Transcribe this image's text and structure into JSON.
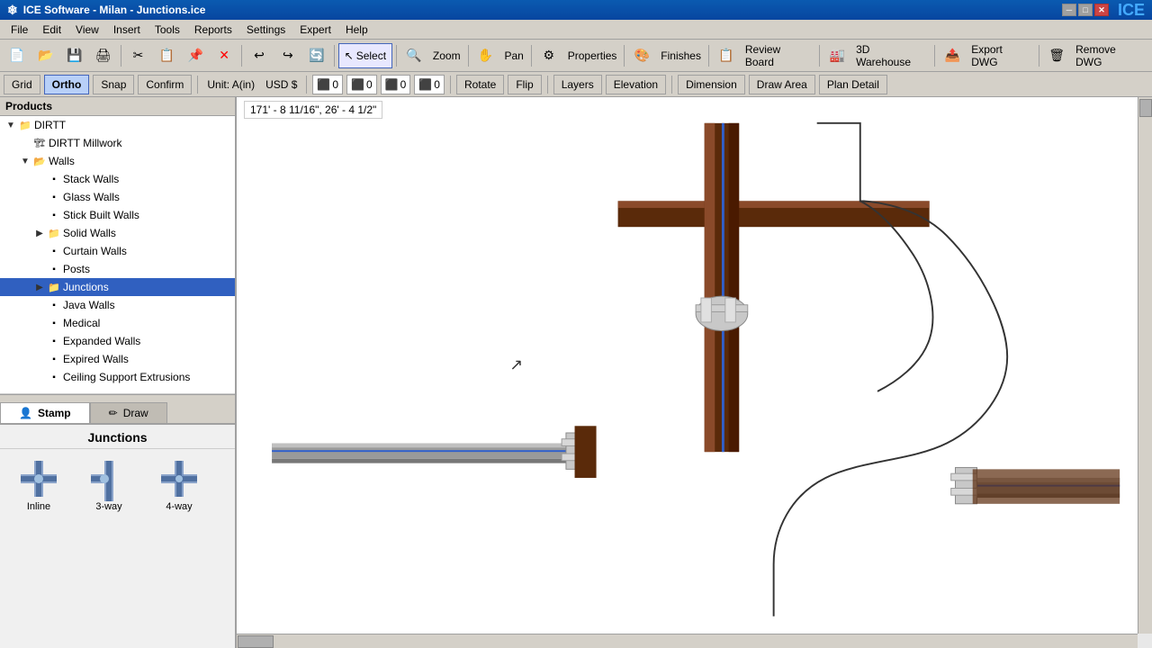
{
  "titlebar": {
    "title": "ICE Software - Milan - Junctions.ice",
    "logo": "ICE",
    "controls": [
      "─",
      "□",
      "✕"
    ]
  },
  "menu": {
    "items": [
      "File",
      "Edit",
      "View",
      "Insert",
      "Tools",
      "Reports",
      "Settings",
      "Expert",
      "Help"
    ]
  },
  "toolbar": {
    "select_label": "Select",
    "zoom_label": "Zoom",
    "pan_label": "Pan",
    "properties_label": "Properties",
    "finishes_label": "Finishes",
    "review_board_label": "Review Board",
    "warehouse_label": "3D Warehouse",
    "export_dwg_label": "Export DWG",
    "remove_dwg_label": "Remove DWG"
  },
  "toolbar2": {
    "grid_label": "Grid",
    "ortho_label": "Ortho",
    "snap_label": "Snap",
    "confirm_label": "Confirm",
    "unit_label": "Unit: A(in)",
    "currency_label": "USD $",
    "counters": [
      {
        "icon": "🔴",
        "value": "0"
      },
      {
        "icon": "🟡",
        "value": "0"
      },
      {
        "icon": "🟢",
        "value": "0"
      },
      {
        "icon": "🟠",
        "value": "0"
      }
    ],
    "rotate_label": "Rotate",
    "flip_label": "Flip",
    "layers_label": "Layers",
    "elevation_label": "Elevation",
    "dimension_label": "Dimension",
    "draw_area_label": "Draw Area",
    "plan_detail_label": "Plan Detail"
  },
  "tree": {
    "header": "Products",
    "nodes": [
      {
        "id": "dirtt",
        "label": "DIRTT",
        "level": 0,
        "expandable": true,
        "expanded": true,
        "type": "folder"
      },
      {
        "id": "dirtt-millwork",
        "label": "DIRTT Millwork",
        "level": 1,
        "expandable": false,
        "type": "item"
      },
      {
        "id": "walls",
        "label": "Walls",
        "level": 1,
        "expandable": true,
        "expanded": true,
        "type": "folder"
      },
      {
        "id": "stack-walls",
        "label": "Stack Walls",
        "level": 2,
        "expandable": false,
        "type": "item"
      },
      {
        "id": "glass-walls",
        "label": "Glass Walls",
        "level": 2,
        "expandable": false,
        "type": "item"
      },
      {
        "id": "stick-built-walls",
        "label": "Stick Built Walls",
        "level": 2,
        "expandable": false,
        "type": "item"
      },
      {
        "id": "solid-walls",
        "label": "Solid Walls",
        "level": 2,
        "expandable": true,
        "expanded": false,
        "type": "folder"
      },
      {
        "id": "curtain-walls",
        "label": "Curtain Walls",
        "level": 2,
        "expandable": false,
        "type": "item"
      },
      {
        "id": "posts",
        "label": "Posts",
        "level": 2,
        "expandable": false,
        "type": "item"
      },
      {
        "id": "junctions",
        "label": "Junctions",
        "level": 2,
        "expandable": true,
        "selected": true,
        "type": "folder"
      },
      {
        "id": "java-walls",
        "label": "Java Walls",
        "level": 2,
        "expandable": false,
        "type": "item"
      },
      {
        "id": "medical",
        "label": "Medical",
        "level": 2,
        "expandable": false,
        "type": "item"
      },
      {
        "id": "expanded-walls",
        "label": "Expanded Walls",
        "level": 2,
        "expandable": false,
        "type": "item"
      },
      {
        "id": "expired-walls",
        "label": "Expired Walls",
        "level": 2,
        "expandable": false,
        "type": "item"
      },
      {
        "id": "ceiling-support",
        "label": "Ceiling Support Extrusions",
        "level": 2,
        "expandable": false,
        "type": "item"
      }
    ]
  },
  "tabs": [
    {
      "id": "stamp",
      "label": "Stamp",
      "icon": "👤",
      "active": true
    },
    {
      "id": "draw",
      "label": "Draw",
      "icon": "✏️",
      "active": false
    }
  ],
  "junctions": {
    "title": "Junctions",
    "items": [
      {
        "id": "inline",
        "label": "Inline"
      },
      {
        "id": "3way",
        "label": "3-way"
      },
      {
        "id": "4way",
        "label": "4-way"
      }
    ]
  },
  "canvas": {
    "coords": "171' - 8 11/16\", 26' - 4 1/2\""
  }
}
